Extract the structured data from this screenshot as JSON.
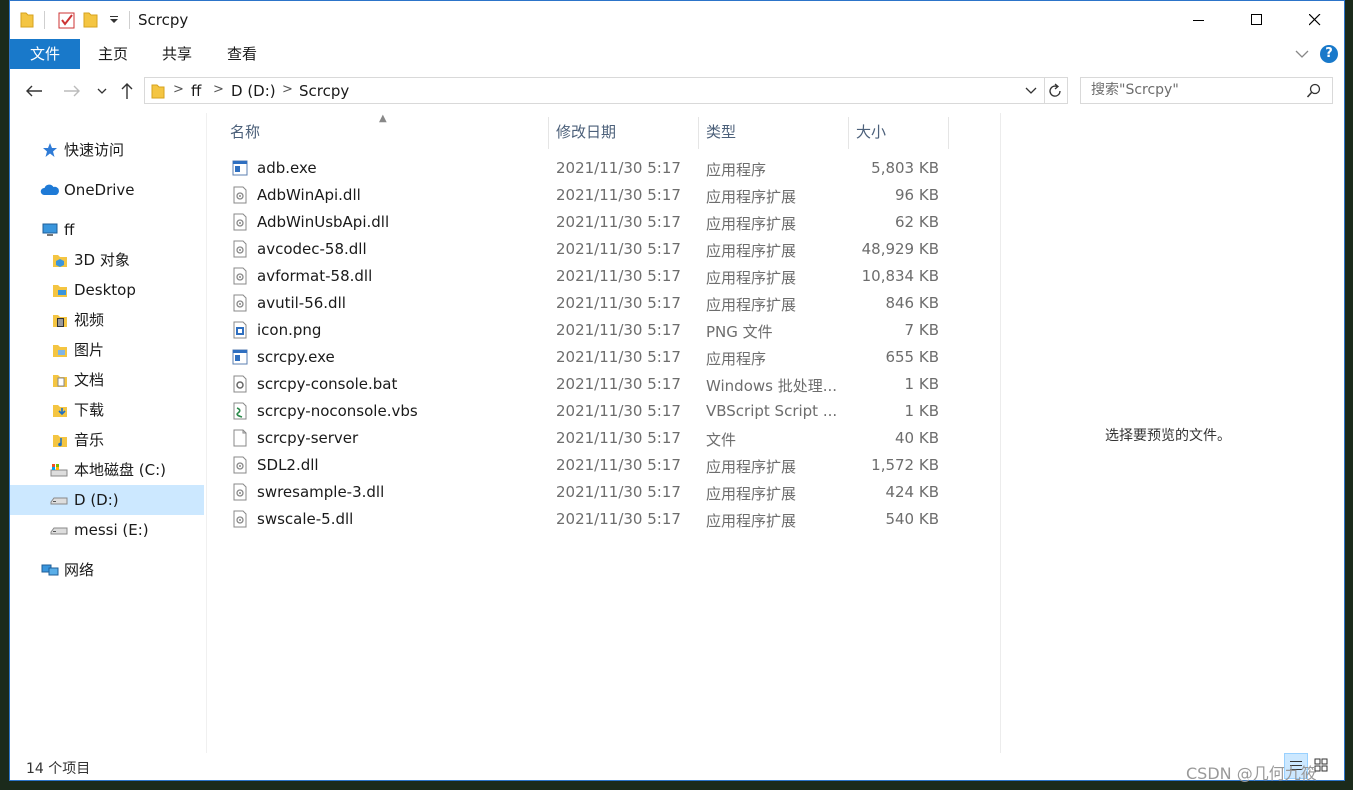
{
  "window": {
    "title": "Scrcpy"
  },
  "ribbon": {
    "tabs": [
      "文件",
      "主页",
      "共享",
      "查看"
    ]
  },
  "breadcrumb": [
    "ff",
    "D (D:)",
    "Scrcpy"
  ],
  "search": {
    "placeholder": "搜索\"Scrcpy\""
  },
  "sidebar": {
    "items": [
      {
        "label": "快速访问",
        "icon": "star-icon"
      },
      {
        "label": "OneDrive",
        "icon": "cloud-icon"
      },
      {
        "label": "ff",
        "icon": "computer-icon"
      },
      {
        "label": "3D 对象",
        "icon": "3d-objects-icon"
      },
      {
        "label": "Desktop",
        "icon": "desktop-folder-icon"
      },
      {
        "label": "视频",
        "icon": "video-folder-icon"
      },
      {
        "label": "图片",
        "icon": "pictures-folder-icon"
      },
      {
        "label": "文档",
        "icon": "documents-folder-icon"
      },
      {
        "label": "下载",
        "icon": "downloads-folder-icon"
      },
      {
        "label": "音乐",
        "icon": "music-folder-icon"
      },
      {
        "label": "本地磁盘 (C:)",
        "icon": "drive-c-icon"
      },
      {
        "label": "D (D:)",
        "icon": "drive-icon"
      },
      {
        "label": "messi (E:)",
        "icon": "drive-icon"
      },
      {
        "label": "网络",
        "icon": "network-icon"
      }
    ]
  },
  "columns": {
    "name": "名称",
    "date": "修改日期",
    "type": "类型",
    "size": "大小"
  },
  "files": [
    {
      "name": "adb.exe",
      "date": "2021/11/30 5:17",
      "type": "应用程序",
      "size": "5,803 KB",
      "icon": "exe-icon"
    },
    {
      "name": "AdbWinApi.dll",
      "date": "2021/11/30 5:17",
      "type": "应用程序扩展",
      "size": "96 KB",
      "icon": "dll-icon"
    },
    {
      "name": "AdbWinUsbApi.dll",
      "date": "2021/11/30 5:17",
      "type": "应用程序扩展",
      "size": "62 KB",
      "icon": "dll-icon"
    },
    {
      "name": "avcodec-58.dll",
      "date": "2021/11/30 5:17",
      "type": "应用程序扩展",
      "size": "48,929 KB",
      "icon": "dll-icon"
    },
    {
      "name": "avformat-58.dll",
      "date": "2021/11/30 5:17",
      "type": "应用程序扩展",
      "size": "10,834 KB",
      "icon": "dll-icon"
    },
    {
      "name": "avutil-56.dll",
      "date": "2021/11/30 5:17",
      "type": "应用程序扩展",
      "size": "846 KB",
      "icon": "dll-icon"
    },
    {
      "name": "icon.png",
      "date": "2021/11/30 5:17",
      "type": "PNG 文件",
      "size": "7 KB",
      "icon": "png-icon"
    },
    {
      "name": "scrcpy.exe",
      "date": "2021/11/30 5:17",
      "type": "应用程序",
      "size": "655 KB",
      "icon": "exe-icon"
    },
    {
      "name": "scrcpy-console.bat",
      "date": "2021/11/30 5:17",
      "type": "Windows 批处理...",
      "size": "1 KB",
      "icon": "bat-icon"
    },
    {
      "name": "scrcpy-noconsole.vbs",
      "date": "2021/11/30 5:17",
      "type": "VBScript Script ...",
      "size": "1 KB",
      "icon": "vbs-icon"
    },
    {
      "name": "scrcpy-server",
      "date": "2021/11/30 5:17",
      "type": "文件",
      "size": "40 KB",
      "icon": "file-icon"
    },
    {
      "name": "SDL2.dll",
      "date": "2021/11/30 5:17",
      "type": "应用程序扩展",
      "size": "1,572 KB",
      "icon": "dll-icon"
    },
    {
      "name": "swresample-3.dll",
      "date": "2021/11/30 5:17",
      "type": "应用程序扩展",
      "size": "424 KB",
      "icon": "dll-icon"
    },
    {
      "name": "swscale-5.dll",
      "date": "2021/11/30 5:17",
      "type": "应用程序扩展",
      "size": "540 KB",
      "icon": "dll-icon"
    }
  ],
  "preview": {
    "empty_text": "选择要预览的文件。"
  },
  "status": {
    "count": "14 个项目"
  },
  "watermark": "CSDN @几何九筱",
  "colors": {
    "accent": "#1979ca",
    "selected": "#cce8ff",
    "folder": "#f4c542"
  }
}
